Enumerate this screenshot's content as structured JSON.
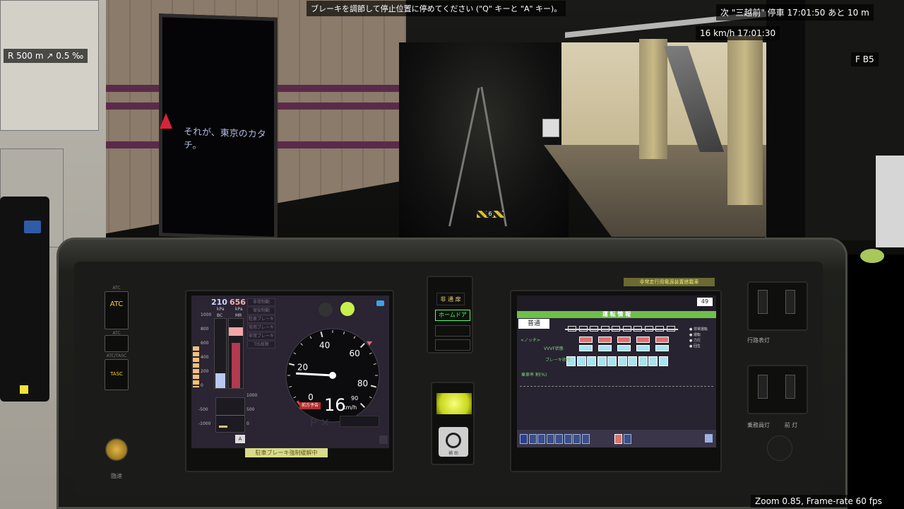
{
  "hud": {
    "instruction": "ブレーキを調節して停止位置に停めてください (\"Q\" キーと \"A\" キー)。",
    "next_stop": "次 \"三越前\" 停車 17:01:50 あと 10 m",
    "speed_time": "16 km/h  17:01:30",
    "curve_grade": "R 500 m  ↗ 0.5 ‰",
    "notch": "F  B5",
    "footer": "Zoom 0.85, Frame-rate 60 fps"
  },
  "scene": {
    "track_marker": "6",
    "poster_text": "それが、東京のカタチ。"
  },
  "left_panel": {
    "atc_label": "ATC",
    "atc_caption": "ATC",
    "tasc_label": "TASC",
    "tasc_caption": "ATC/TASC",
    "yield_caption": "臨速"
  },
  "center_panel": {
    "door_top_label": "非 通 扉",
    "platform_door_label": "ホームドア",
    "door_switch_caption": "補 助"
  },
  "gauge_screen": {
    "bc_value": "210",
    "mr_value": "656",
    "pressure_unit": "kPa",
    "bc_label": "BC",
    "mr_label": "MR",
    "indicators": [
      "非常制動",
      "保安制動",
      "駐車ブレーキ",
      "常用ブレーキ",
      "非常ブレーキ",
      "TIS故障"
    ],
    "scale_ticks": [
      "1000",
      "800",
      "600",
      "400",
      "200",
      "0"
    ],
    "current_ticks": [
      "1000",
      "500",
      "0",
      "-500",
      "-1000"
    ],
    "current_unit": "A",
    "dial_ticks": [
      "0",
      "20",
      "40",
      "60",
      "80",
      "90"
    ],
    "speed_value": "16",
    "speed_unit": "km/h",
    "warn_label": "前方予告",
    "status_bar": "駐車ブレーキ強制緩解中",
    "speed_numeric": 16,
    "bc_fill": 0.21,
    "mr_fill": 0.656
  },
  "ops_screen": {
    "top_strip": "非常走行用電源装置搭載車",
    "car_count_label": "49",
    "title": "運 転 情 報",
    "train_type": "普通",
    "notch_label": "<ノッチ>",
    "vvvf_label": "VVVF状態",
    "brake_label": "ブレーキ状態",
    "load_label": "乗車率  割(%)",
    "legend": [
      "非常運転",
      "運転",
      "力行",
      "回生"
    ],
    "tabs": [
      "運転",
      "空調",
      "ドア",
      "設定",
      "車両",
      "編成",
      "補助",
      "故障"
    ]
  },
  "right_panel": {
    "switch1_caption": "行路表灯",
    "switch2_caption": "乗務員灯",
    "switch3_caption": "前 灯"
  }
}
